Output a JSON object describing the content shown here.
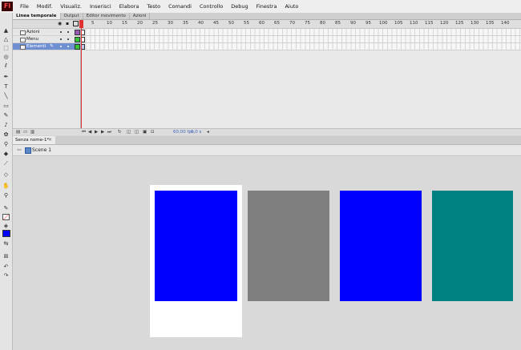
{
  "app": {
    "logo": "Fl"
  },
  "menu": [
    "File",
    "Modif.",
    "Visualiz.",
    "Inserisci",
    "Elabora",
    "Testo",
    "Comandi",
    "Controllo",
    "Debug",
    "Finestra",
    "Aiuto"
  ],
  "timeline": {
    "tabs": [
      "Linea temporale",
      "Output",
      "Editor movimento",
      "Azioni"
    ],
    "layers": [
      {
        "name": "Azioni",
        "color": "#9b59b6"
      },
      {
        "name": "Menu",
        "color": "#35c435"
      },
      {
        "name": "Elementi",
        "color": "#35c435",
        "selected": true
      }
    ],
    "frame_numbers": [
      "5",
      "10",
      "15",
      "20",
      "25",
      "30",
      "35",
      "40",
      "45",
      "50",
      "55",
      "60",
      "65",
      "70",
      "75",
      "80",
      "85",
      "90",
      "95",
      "100",
      "105",
      "110",
      "115",
      "120",
      "125",
      "130",
      "135",
      "140"
    ],
    "fps": "60,00 fps",
    "time": "0,0 s"
  },
  "document": {
    "tab": "Senza nome-1*",
    "scene": "Scene 1"
  },
  "colors": {
    "blue": "#0000ff",
    "gray": "#7f7f7f",
    "teal": "#008080"
  },
  "icons": [
    "selection-tool-icon",
    "subselection-tool-icon",
    "free-transform-icon",
    "3d-rotation-icon",
    "lasso-icon",
    "pen-icon",
    "text-tool-icon",
    "line-tool-icon",
    "rectangle-tool-icon",
    "pencil-icon",
    "brush-icon",
    "deco-icon",
    "bone-icon",
    "paint-bucket-icon",
    "eyedropper-icon",
    "eraser-icon",
    "hand-tool-icon",
    "zoom-tool-icon",
    "stroke-color-icon",
    "fill-color-icon",
    "swap-colors-icon"
  ]
}
